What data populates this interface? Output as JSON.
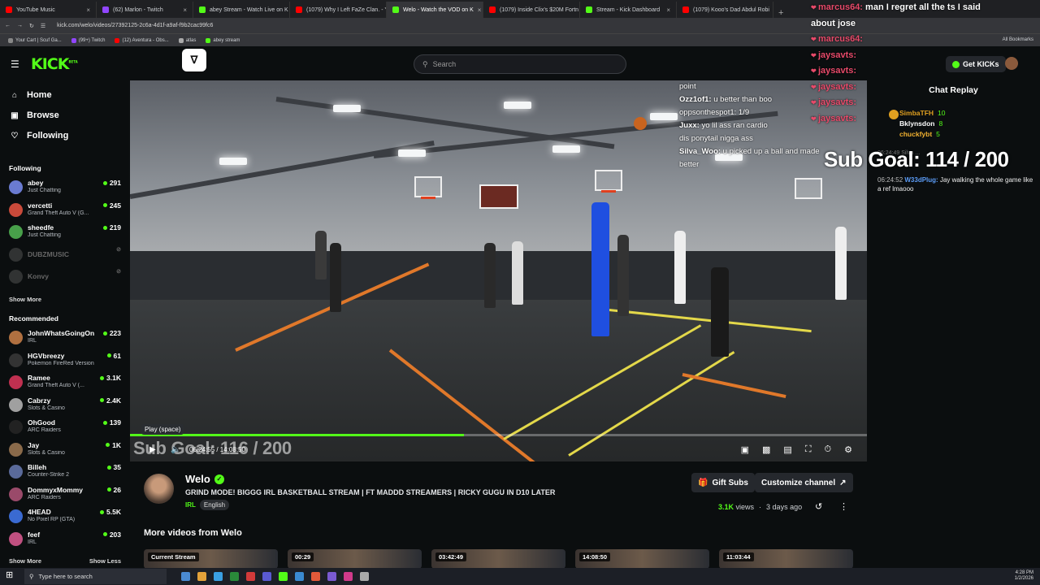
{
  "browser": {
    "tabs": [
      {
        "label": "YouTube Music",
        "color": "#ff0000"
      },
      {
        "label": "(62) Marlon - Twitch",
        "color": "#9146ff"
      },
      {
        "label": "abey Stream - Watch Live on K",
        "color": "#53fc18"
      },
      {
        "label": "(1079) Why I Left FaZe Clan. - Y",
        "color": "#ff0000"
      },
      {
        "label": "Welo - Watch the VOD on K",
        "color": "#53fc18",
        "active": true
      },
      {
        "label": "(1079) Inside Clix's $20M Fortn",
        "color": "#ff0000"
      },
      {
        "label": "Stream - Kick Dashboard",
        "color": "#53fc18"
      },
      {
        "label": "(1079) Kooo's Dad Abdul Robi",
        "color": "#ff0000"
      }
    ],
    "url": "kick.com/welo/videos/27392125-2c6a-4d1f-a9af-f9b2cac99fc6",
    "bookmarks": [
      {
        "label": "Your Cart | Scuf Ga...",
        "color": "#888"
      },
      {
        "label": "(99+) Twitch",
        "color": "#9146ff"
      },
      {
        "label": "(12) Aventura - Obs...",
        "color": "#ff0000"
      },
      {
        "label": "atlas",
        "color": "#aaa"
      },
      {
        "label": "abey stream",
        "color": "#53fc18"
      }
    ],
    "all_bookmarks": "All Bookmarks"
  },
  "header": {
    "logo": "KICK",
    "logo_sup": "BETA",
    "search_placeholder": "Search",
    "get_kicks": "Get KICKs"
  },
  "sidebar": {
    "nav": [
      {
        "label": "Home",
        "icon": "home-icon"
      },
      {
        "label": "Browse",
        "icon": "browse-icon"
      },
      {
        "label": "Following",
        "icon": "heart-icon"
      }
    ],
    "following_title": "Following",
    "following": [
      {
        "name": "abey",
        "category": "Just Chatting",
        "viewers": "291",
        "color": "#6a7bd1"
      },
      {
        "name": "vercetti",
        "category": "Grand Theft Auto V (G...",
        "viewers": "245",
        "color": "#c94a3a"
      },
      {
        "name": "sheedfe",
        "category": "Just Chatting",
        "viewers": "219",
        "color": "#48a04a"
      },
      {
        "name": "DUBZMUSIC",
        "category": "",
        "viewers": "",
        "color": "#777",
        "offline": true
      },
      {
        "name": "Konvy",
        "category": "",
        "viewers": "",
        "color": "#777",
        "offline": true
      }
    ],
    "show_more": "Show More",
    "recommended_title": "Recommended",
    "recommended": [
      {
        "name": "JohnWhatsGoingOn",
        "category": "IRL",
        "viewers": "223",
        "color": "#b07040"
      },
      {
        "name": "HGVbreezy",
        "category": "Pokemon FireRed Version",
        "viewers": "61",
        "color": "#333"
      },
      {
        "name": "Ramee",
        "category": "Grand Theft Auto V (...",
        "viewers": "3.1K",
        "color": "#c03050"
      },
      {
        "name": "Cabrzy",
        "category": "Slots & Casino",
        "viewers": "2.4K",
        "color": "#a0a0a0"
      },
      {
        "name": "OhGood",
        "category": "ARC Raiders",
        "viewers": "139",
        "color": "#222"
      },
      {
        "name": "Jay",
        "category": "Slots & Casino",
        "viewers": "1K",
        "color": "#8a6a4a"
      },
      {
        "name": "Billeh",
        "category": "Counter-Strike 2",
        "viewers": "35",
        "color": "#5a6a9a"
      },
      {
        "name": "DommyxMommy",
        "category": "ARC Raiders",
        "viewers": "26",
        "color": "#9a4a6a"
      },
      {
        "name": "4HEAD",
        "category": "No Pixel RP (GTA)",
        "viewers": "5.5K",
        "color": "#3a6ad1"
      },
      {
        "name": "feef",
        "category": "IRL",
        "viewers": "203",
        "color": "#c05080"
      }
    ],
    "show_more_2": "Show More",
    "show_less": "Show Less"
  },
  "video": {
    "overlay_chat": [
      {
        "user": "",
        "text": "point"
      },
      {
        "user": "Ozz1of1:",
        "text": "u better than boo"
      },
      {
        "user": "",
        "text": "oppsonthespot1: 1/9"
      },
      {
        "user": "Juxx:",
        "text": "yo lil ass ran cardio"
      },
      {
        "user": "",
        "text": "dis ponytail nigga ass"
      },
      {
        "user": "Silva_Woo:",
        "text": "u picked up a ball and made"
      },
      {
        "user": "",
        "text": "better"
      }
    ],
    "sub_goal": "Sub Goal: 116 / 200",
    "tooltip": "Play (space)",
    "time": "06:24:55 / 14:08:50",
    "progress": 0.453
  },
  "channel": {
    "name": "Welo",
    "title": "GRIND MODE! BIGGG IRL BASKETBALL STREAM | FT MADDD STREAMERS | RICKY GUGU IN D10 LATER",
    "category": "IRL",
    "language": "English",
    "gift_subs": "Gift Subs",
    "customize": "Customize channel",
    "views": "3.1K",
    "views_label": "views",
    "ago": "3 days ago"
  },
  "more_videos": {
    "title": "More videos from Welo",
    "items": [
      "Current Stream",
      "00:29",
      "03:42:49",
      "14:08:50",
      "11:03:44"
    ]
  },
  "chat_replay": {
    "title": "Chat Replay",
    "gifters": [
      {
        "name": "SimbaTFH",
        "count": "10"
      },
      {
        "name": "Bklynsdon",
        "count": "8"
      },
      {
        "name": "chuckfybt",
        "count": "5"
      }
    ],
    "faded": "06:24:49 Silva ...",
    "message": {
      "time": "06:24:52",
      "user": "W33dPlug:",
      "text": "Jay walking the whole game like a ref lmaooo"
    },
    "sub_goal": "Sub Goal: 114 / 200"
  },
  "stream_chat": [
    {
      "user": "marcus64:",
      "text": "man I regret all the ts I said"
    },
    {
      "user": "",
      "text": "about jose"
    },
    {
      "user": "marcus64:",
      "text": ""
    },
    {
      "user": "jaysavts:",
      "text": ""
    },
    {
      "user": "jaysavts:",
      "text": ""
    },
    {
      "user": "jaysavts:",
      "text": ""
    },
    {
      "user": "jaysavts:",
      "text": ""
    },
    {
      "user": "jaysavts:",
      "text": ""
    }
  ],
  "taskbar": {
    "search": "Type here to search",
    "time": "4:28 PM",
    "date": "1/2/2026"
  }
}
